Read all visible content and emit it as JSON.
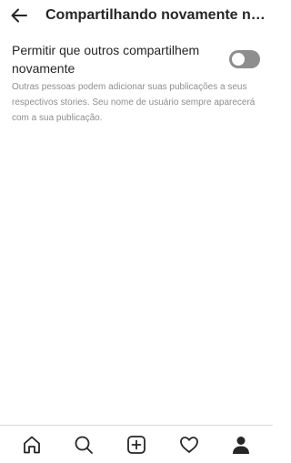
{
  "header": {
    "title": "Compartilhando novamente no Stories",
    "back_icon": "arrow-left-icon"
  },
  "setting": {
    "label": "Permitir que outros compartilhem novamente",
    "toggle_state": "off",
    "description": "Outras pessoas podem adicionar suas publicações a seus respectivos stories. Seu nome de usuário sempre aparecerá com a sua publicação."
  },
  "bottom_nav": {
    "items": [
      {
        "icon": "home-icon"
      },
      {
        "icon": "search-icon"
      },
      {
        "icon": "new-post-icon"
      },
      {
        "icon": "heart-icon"
      },
      {
        "icon": "profile-icon"
      }
    ]
  },
  "colors": {
    "text": "#262626",
    "secondary_text": "#8e8e8e",
    "toggle_off": "#8e8e8e",
    "divider": "#dbdbdb"
  }
}
